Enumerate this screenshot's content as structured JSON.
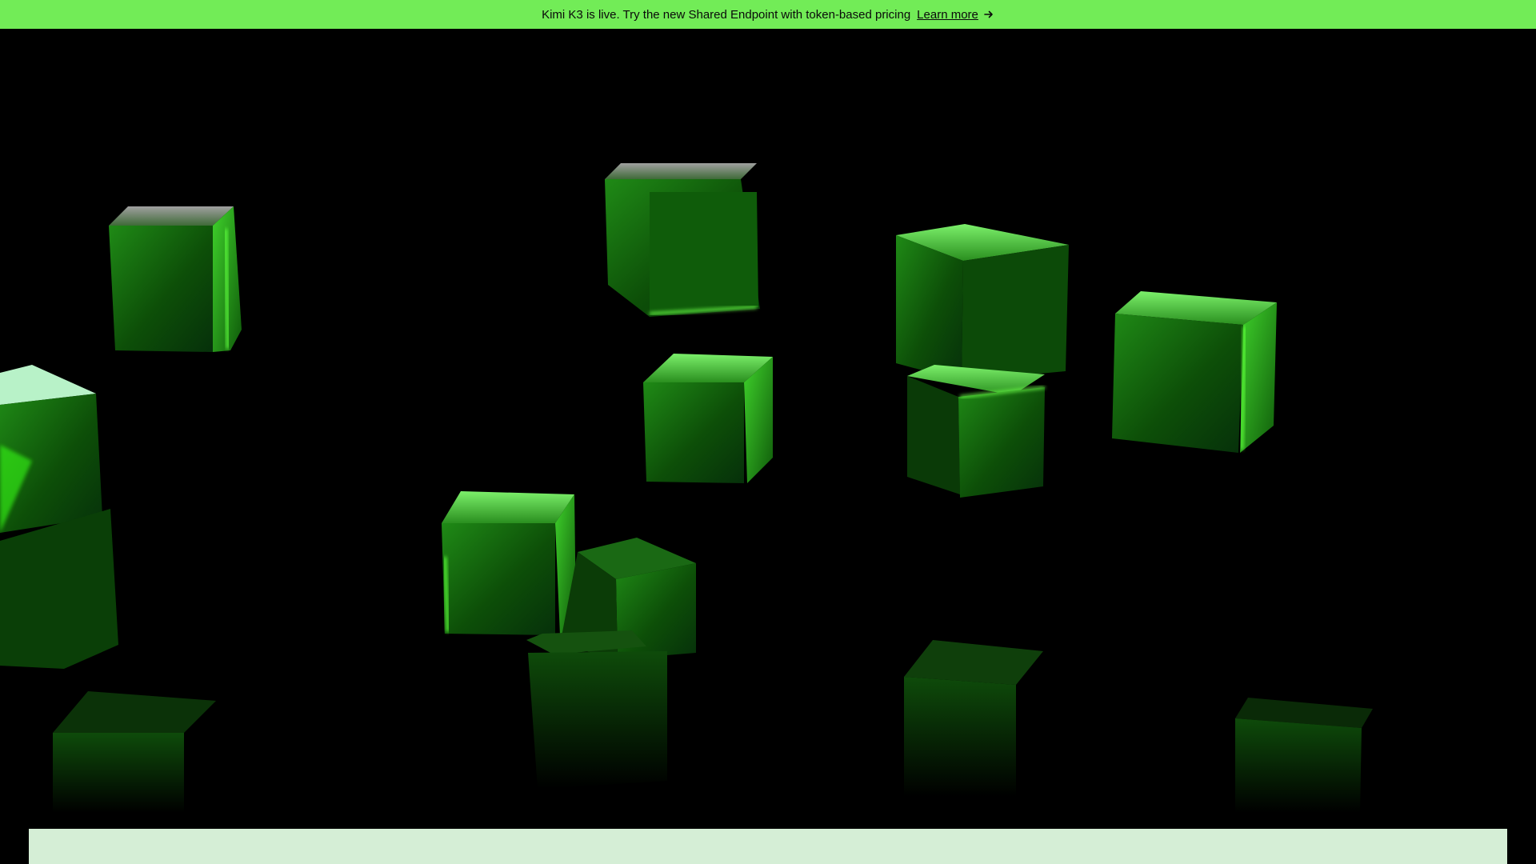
{
  "announcement": {
    "text": "Kimi K3 is live. Try the new Shared Endpoint with token-based pricing",
    "link_label": "Learn more",
    "link_icon": "arrow-right-icon"
  },
  "colors": {
    "banner_bg": "#72ec57",
    "hero_bg": "#000000",
    "cube_accent": "#39ff14",
    "panel_bg": "#d5eed6"
  },
  "hero": {
    "graphic": "floating-green-cubes"
  }
}
